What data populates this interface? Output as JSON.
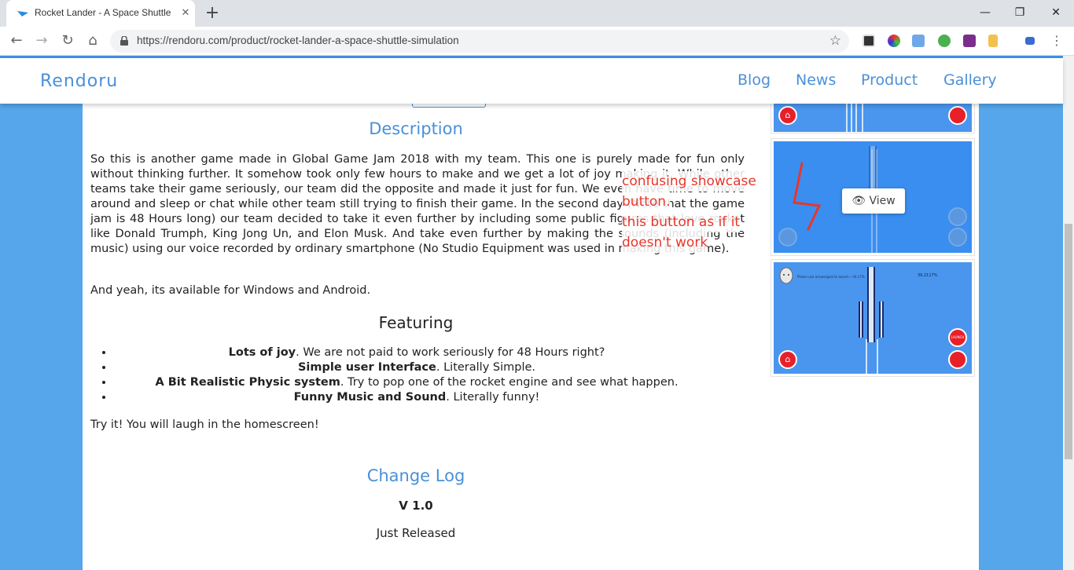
{
  "browser": {
    "tab_title": "Rocket Lander - A Space Shuttle",
    "url": "https://rendoru.com/product/rocket-lander-a-space-shuttle-simulation",
    "close_glyph": "✕",
    "newtab_glyph": "+",
    "minimize_glyph": "—",
    "restore_glyph": "❐",
    "window_close_glyph": "✕",
    "back_glyph": "←",
    "forward_glyph": "→",
    "reload_glyph": "↻",
    "home_glyph": "⌂",
    "star_glyph": "☆",
    "menu_glyph": "⋮"
  },
  "site": {
    "brand": "Rendoru",
    "nav": [
      "Blog",
      "News",
      "Product",
      "Gallery"
    ]
  },
  "content": {
    "description_title": "Description",
    "description_text": "So this is another game made in Global Game Jam 2018 with my team. This one is purely made for fun only without thinking further. It somehow took only few hours to make and we get a lot of joy making it. While other teams take their game seriously, our team did the opposite and made it just for fun. We even have time to move around and sleep or chat while other team still trying to finish their game. In the second day (Note that the game jam is 48 Hours long) our team decided to take it even further by including some public figures that love rocket like Donald Trumph, King Jong Un, and Elon Musk. And take even further by making the sounds (including the music) using our voice recorded by ordinary smartphone (No Studio Equipment was used in making this game).",
    "availability_text": "And yeah, its available for Windows and Android.",
    "featuring_title": "Featuring",
    "features": [
      {
        "bold": "Lots of joy",
        "rest": ". We are not paid to work seriously for 48 Hours right?"
      },
      {
        "bold": "Simple user Interface",
        "rest": ". Literally Simple."
      },
      {
        "bold": "A Bit Realistic Physic system",
        "rest": ". Try to pop one of the rocket engine and see what happen."
      },
      {
        "bold": "Funny Music and Sound",
        "rest": ". Literally funny!"
      }
    ],
    "try_text": "Try it! You will laugh in the homescreen!",
    "changelog_title": "Change Log",
    "version": "V 1.0",
    "release_note": "Just Released"
  },
  "sidebar": {
    "view_button_label": "View",
    "eye_glyph": "👁",
    "home_glyph": "⌂",
    "shot3_caption": "Please use arrows/goal to launch ~34.17%",
    "shot3_value": "39.2117%",
    "launch_label": "LAUNCH"
  },
  "annotation": {
    "line1": "confusing showcase",
    "line2": "button.",
    "line3": "this button as if it",
    "line4": "doesn't work"
  }
}
